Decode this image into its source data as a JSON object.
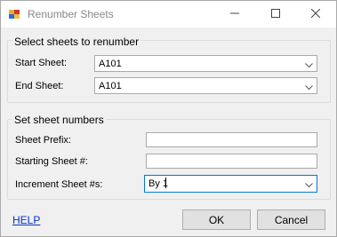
{
  "window": {
    "title": "Renumber Sheets",
    "minimize_symbol": "—",
    "maximize_symbol": "☐",
    "close_symbol": "✕"
  },
  "select_group": {
    "title": "Select sheets to renumber",
    "start_label": "Start Sheet:",
    "start_value": "A101",
    "end_label": "End Sheet:",
    "end_value": "A101"
  },
  "numbers_group": {
    "title": "Set sheet numbers",
    "prefix_label": "Sheet Prefix:",
    "prefix_value": "",
    "starting_label": "Starting Sheet #:",
    "starting_value": "",
    "increment_label": "Increment Sheet #s:",
    "increment_value": "By 1"
  },
  "footer": {
    "help_label": "HELP",
    "ok_label": "OK",
    "cancel_label": "Cancel"
  },
  "icons": {
    "app": "app-icon",
    "chevron": "chevron-down-icon"
  }
}
